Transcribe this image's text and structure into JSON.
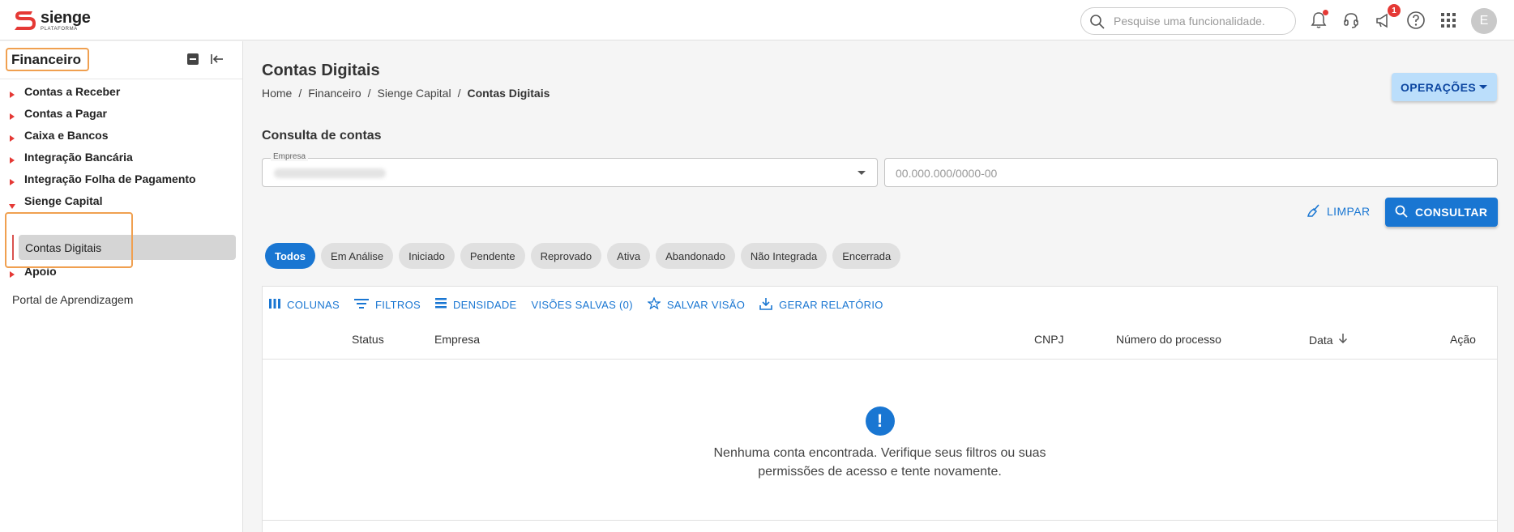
{
  "app": {
    "logo_name": "sienge",
    "logo_sub": "PLATAFORMA",
    "brand_color": "#e53935",
    "accent_color": "#1976d2",
    "highlight_color": "#f0a050"
  },
  "header": {
    "search_placeholder": "Pesquise uma funcionalidade.",
    "icons": [
      "bell-icon",
      "headset-icon",
      "megaphone-icon",
      "help-icon",
      "apps-grid-icon"
    ],
    "megaphone_badge": "1",
    "avatar_initial": "E"
  },
  "sidebar": {
    "title": "Financeiro",
    "items": [
      {
        "label": "Contas a Receber"
      },
      {
        "label": "Contas a Pagar"
      },
      {
        "label": "Caixa e Bancos"
      },
      {
        "label": "Integração Bancária"
      },
      {
        "label": "Integração Folha de Pagamento"
      },
      {
        "label": "Sienge Capital",
        "expanded": true
      },
      {
        "label": "Apoio"
      }
    ],
    "sub_item": "Contas Digitais",
    "footer_link": "Portal de Aprendizagem"
  },
  "main": {
    "title": "Contas Digitais",
    "breadcrumb": [
      "Home",
      "Financeiro",
      "Sienge Capital",
      "Contas Digitais"
    ],
    "breadcrumb_sep": "/",
    "operations_label": "OPERAÇÕES",
    "section_title": "Consulta de contas",
    "empresa_label": "Empresa",
    "cnpj_placeholder": "00.000.000/0000-00",
    "clear_label": "LIMPAR",
    "search_label": "CONSULTAR",
    "status_chips": [
      {
        "label": "Todos",
        "active": true
      },
      {
        "label": "Em Análise"
      },
      {
        "label": "Iniciado"
      },
      {
        "label": "Pendente"
      },
      {
        "label": "Reprovado"
      },
      {
        "label": "Ativa"
      },
      {
        "label": "Abandonado"
      },
      {
        "label": "Não Integrada"
      },
      {
        "label": "Encerrada"
      }
    ],
    "toolbar": {
      "columns": "COLUNAS",
      "filters": "FILTROS",
      "density": "DENSIDADE",
      "saved_views": "VISÕES SALVAS (0)",
      "save_view": "SALVAR VISÃO",
      "report": "GERAR RELATÓRIO"
    },
    "columns": [
      "Status",
      "Empresa",
      "CNPJ",
      "Número do processo",
      "Data",
      "Ação"
    ],
    "empty_message": "Nenhuma conta encontrada. Verifique seus filtros ou suas permissões de acesso e tente novamente."
  }
}
